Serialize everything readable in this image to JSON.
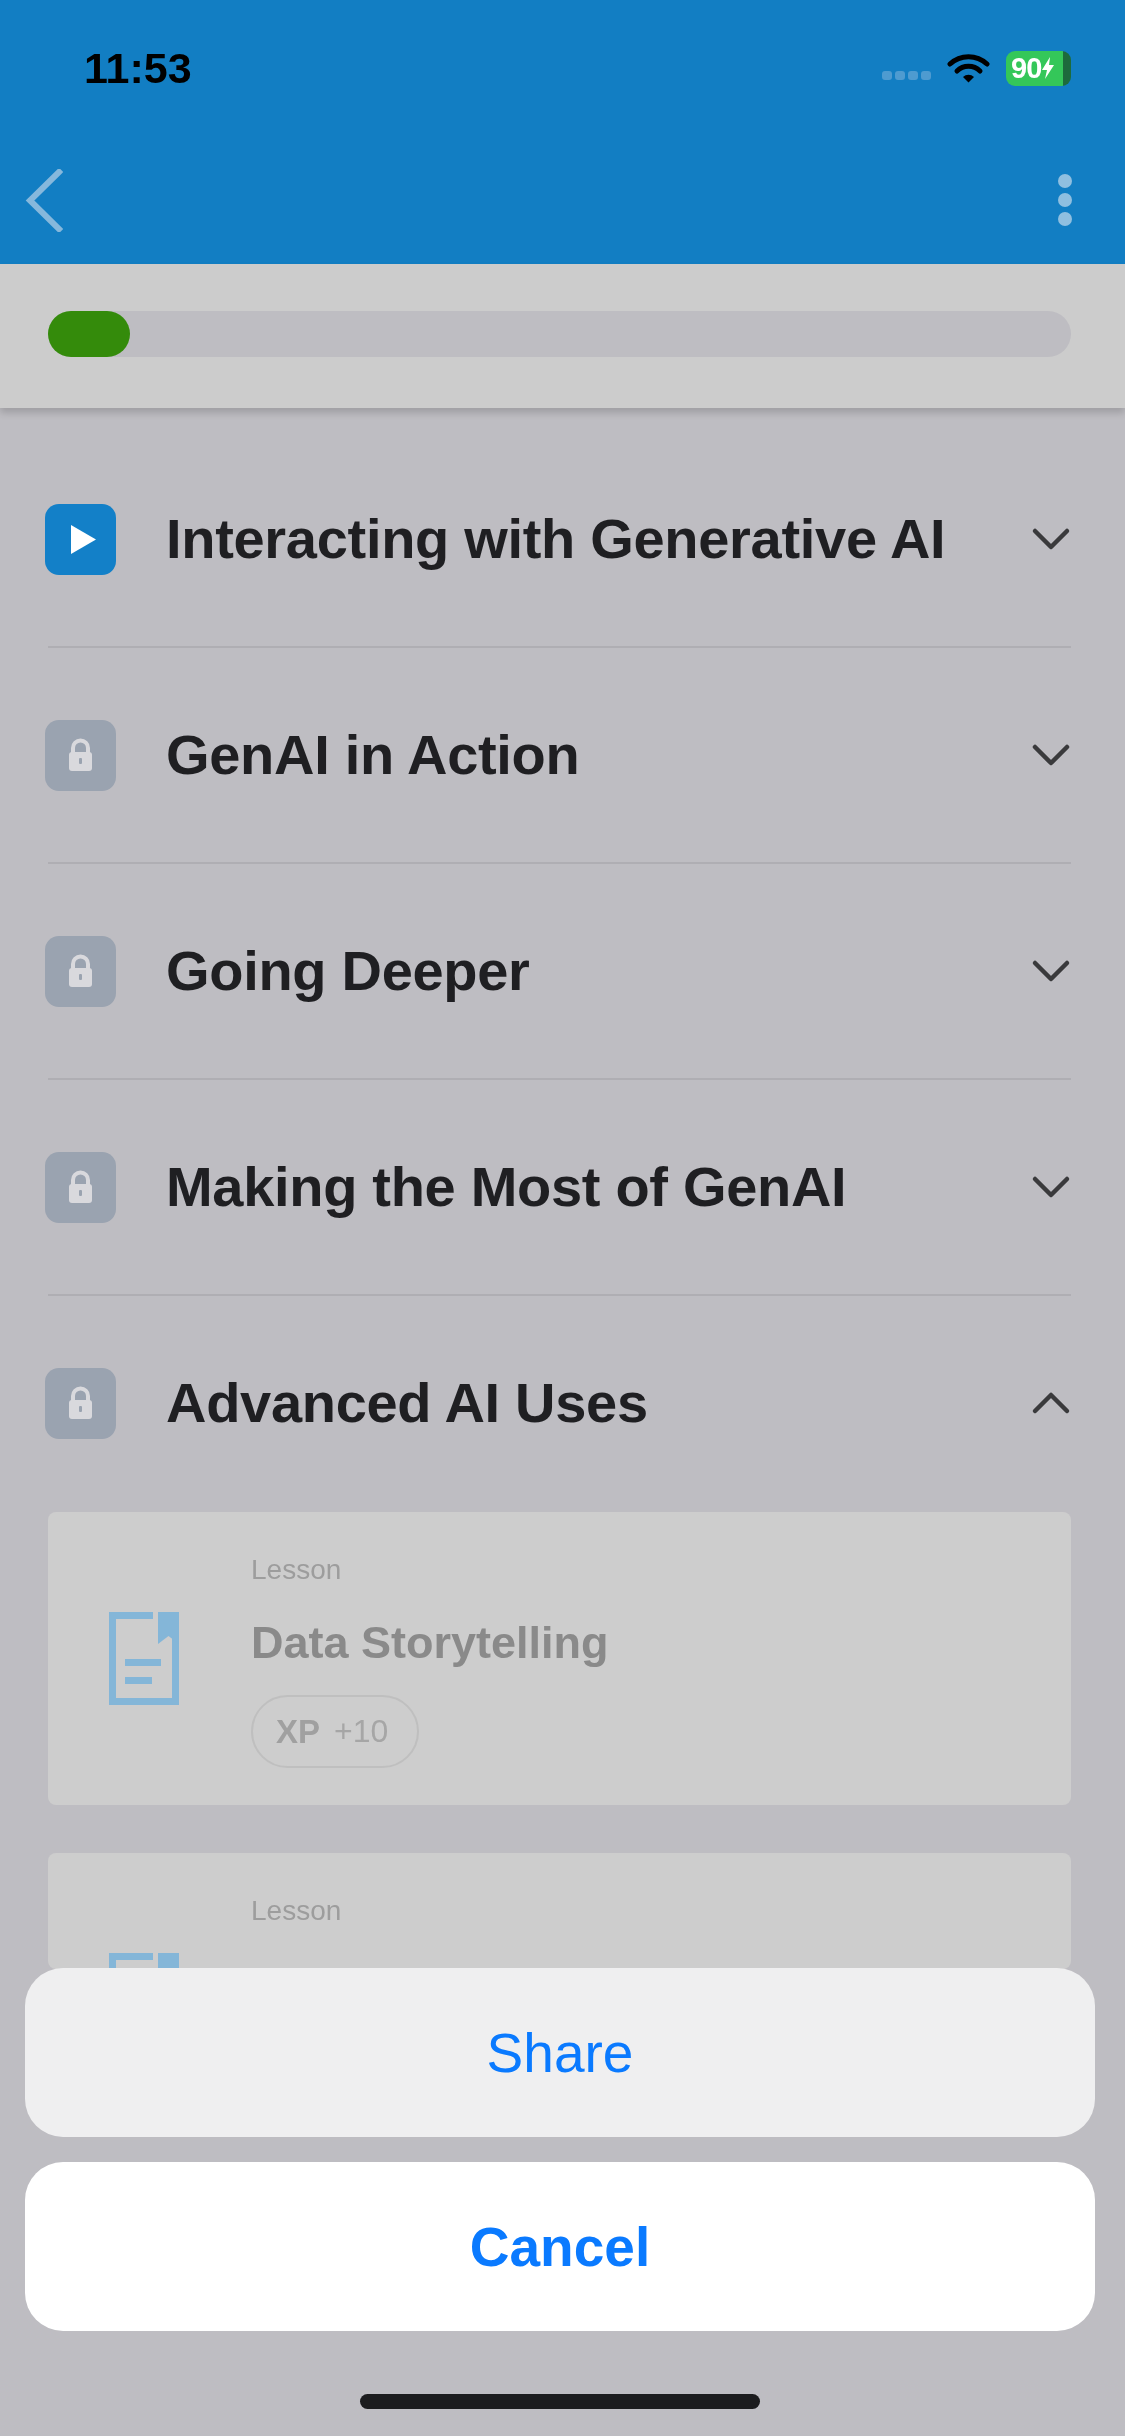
{
  "status_bar": {
    "time": "11:53",
    "battery": "90"
  },
  "progress": {
    "level": 0.08
  },
  "sections": [
    {
      "title": "Interacting with Generative AI",
      "kind": "play",
      "expanded": false
    },
    {
      "title": "GenAI in Action",
      "kind": "locked",
      "expanded": false
    },
    {
      "title": "Going Deeper",
      "kind": "locked",
      "expanded": false
    },
    {
      "title": "Making the Most of GenAI",
      "kind": "locked",
      "expanded": false
    },
    {
      "title": "Advanced AI Uses",
      "kind": "locked",
      "expanded": true,
      "lessons": [
        {
          "type": "Lesson",
          "title": "Data Storytelling",
          "xp_label": "XP",
          "xp": "+10"
        },
        {
          "type": "Lesson"
        }
      ]
    }
  ],
  "action_sheet": {
    "actions": [
      "Share"
    ],
    "cancel": "Cancel"
  }
}
